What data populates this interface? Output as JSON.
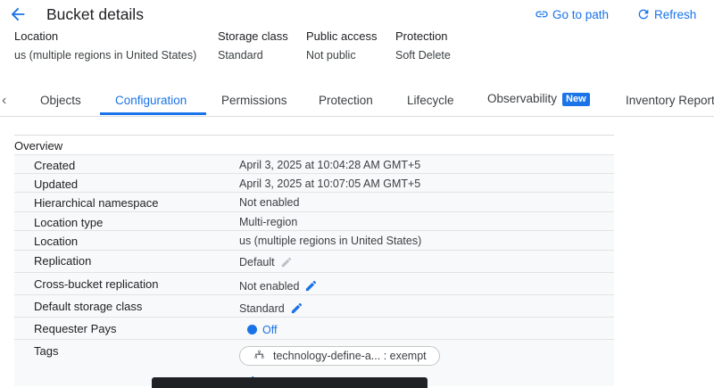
{
  "header": {
    "title": "Bucket details",
    "goto_path": "Go to path",
    "refresh": "Refresh"
  },
  "meta": [
    {
      "key": "Location",
      "value": "us (multiple regions in United States)"
    },
    {
      "key": "Storage class",
      "value": "Standard"
    },
    {
      "key": "Public access",
      "value": "Not public"
    },
    {
      "key": "Protection",
      "value": "Soft Delete"
    }
  ],
  "tabs": [
    {
      "label": "Objects"
    },
    {
      "label": "Configuration",
      "active": true
    },
    {
      "label": "Permissions"
    },
    {
      "label": "Protection"
    },
    {
      "label": "Lifecycle"
    },
    {
      "label": "Observability",
      "badge": "New"
    },
    {
      "label": "Inventory Reports"
    }
  ],
  "overview": {
    "heading": "Overview",
    "rows": [
      {
        "key": "Created",
        "value": "April 3, 2025 at 10:04:28 AM GMT+5"
      },
      {
        "key": "Updated",
        "value": "April 3, 2025 at 10:07:05 AM GMT+5"
      },
      {
        "key": "Hierarchical namespace",
        "value": "Not enabled"
      },
      {
        "key": "Location type",
        "value": "Multi-region"
      },
      {
        "key": "Location",
        "value": "us (multiple regions in United States)"
      },
      {
        "key": "Replication",
        "value": "Default"
      },
      {
        "key": "Cross-bucket replication",
        "value": "Not enabled"
      },
      {
        "key": "Default storage class",
        "value": "Standard"
      },
      {
        "key": "Requester Pays",
        "value": "Off"
      },
      {
        "key": "Tags",
        "value": "technology-define-a... : exempt"
      }
    ]
  },
  "colors": {
    "accent": "#1a73e8",
    "text": "#202124",
    "row_bg": "#f8f9fa"
  }
}
